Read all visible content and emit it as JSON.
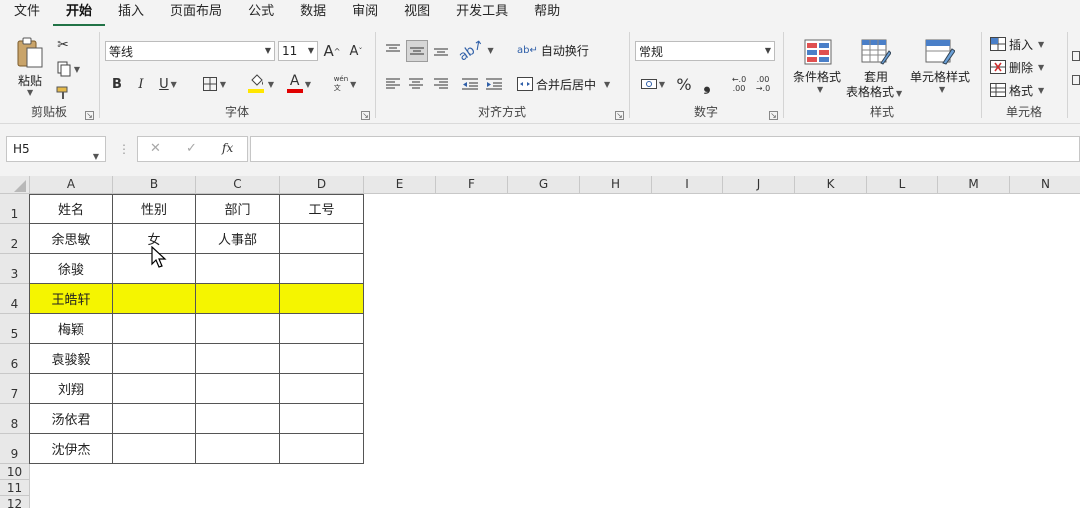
{
  "menu": [
    "文件",
    "开始",
    "插入",
    "页面布局",
    "公式",
    "数据",
    "审阅",
    "视图",
    "开发工具",
    "帮助"
  ],
  "ribbon": {
    "clipboard": {
      "paste": "粘贴",
      "label": "剪贴板"
    },
    "font": {
      "name": "等线",
      "size": "11",
      "label": "字体",
      "bold": "B",
      "italic": "I",
      "underline": "U",
      "grow": "A",
      "shrink": "A",
      "phonetic": "wén\n文",
      "font_color_glyph": "A"
    },
    "align": {
      "wrap": "自动换行",
      "merge": "合并后居中",
      "label": "对齐方式"
    },
    "number": {
      "format": "常规",
      "label": "数字",
      "percent": "%",
      "comma": "❟"
    },
    "styles": {
      "cond": "条件格式",
      "table_line1": "套用",
      "table_line2": "表格格式",
      "cell": "单元格样式",
      "label": "样式"
    },
    "cells": {
      "insert": "插入",
      "delete": "删除",
      "format": "格式",
      "label": "单元格"
    }
  },
  "formula_bar": {
    "name_box": "H5",
    "fx": "fx",
    "cancel": "✕",
    "enter": "✓"
  },
  "columns": [
    "A",
    "B",
    "C",
    "D",
    "E",
    "F",
    "G",
    "H",
    "I",
    "J",
    "K",
    "L",
    "M",
    "N"
  ],
  "rows": [
    "1",
    "2",
    "3",
    "4",
    "5",
    "6",
    "7",
    "8",
    "9",
    "10",
    "11",
    "12"
  ],
  "table": {
    "headers": [
      "姓名",
      "性别",
      "部门",
      "工号"
    ],
    "rows": [
      [
        "余思敏",
        "女",
        "人事部",
        ""
      ],
      [
        "徐骏",
        "",
        "",
        ""
      ],
      [
        "王皓轩",
        "",
        "",
        ""
      ],
      [
        "梅颖",
        "",
        "",
        ""
      ],
      [
        "袁骏毅",
        "",
        "",
        ""
      ],
      [
        "刘翔",
        "",
        "",
        ""
      ],
      [
        "汤依君",
        "",
        "",
        ""
      ],
      [
        "沈伊杰",
        "",
        "",
        ""
      ]
    ]
  },
  "colors": {
    "accent": "#217346",
    "highlight": "#f5f500",
    "font_red": "#e00000",
    "fill_yellow": "#ffe600"
  }
}
